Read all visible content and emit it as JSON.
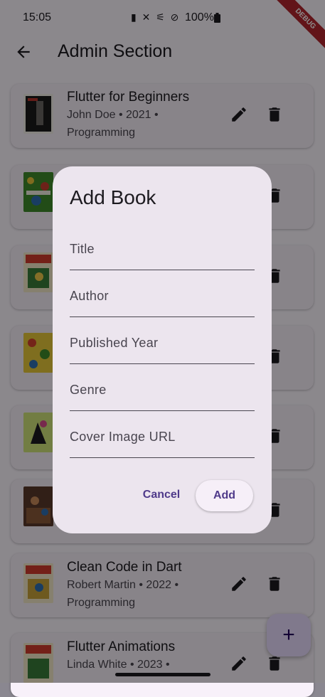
{
  "status_bar": {
    "time": "15:05",
    "icons": "▮ ✕ ⚟ ⊘",
    "battery": "100%",
    "debug_label": "DEBUG"
  },
  "app_bar": {
    "back_icon": "arrow-left-icon",
    "title": "Admin Section"
  },
  "books": [
    {
      "title": "Flutter for Beginners",
      "subtitle": "John Doe • 2021 • Programming"
    },
    {
      "title": "",
      "subtitle": ""
    },
    {
      "title": "",
      "subtitle": ""
    },
    {
      "title": "",
      "subtitle": ""
    },
    {
      "title": "",
      "subtitle": ""
    },
    {
      "title": "",
      "subtitle": ""
    },
    {
      "title": "Clean Code in Dart",
      "subtitle": "Robert Martin • 2022 • Programming"
    },
    {
      "title": "Flutter Animations",
      "subtitle": "Linda White • 2023 •"
    }
  ],
  "dialog": {
    "title": "Add Book",
    "fields": [
      {
        "label": "Title"
      },
      {
        "label": "Author"
      },
      {
        "label": "Published Year"
      },
      {
        "label": "Genre"
      },
      {
        "label": "Cover Image URL"
      }
    ],
    "cancel_label": "Cancel",
    "add_label": "Add"
  },
  "fab": {
    "icon": "+"
  },
  "colors": {
    "accent": "#4f3a8a",
    "dialog_bg": "#ece5ee",
    "debug": "#b3262e"
  }
}
